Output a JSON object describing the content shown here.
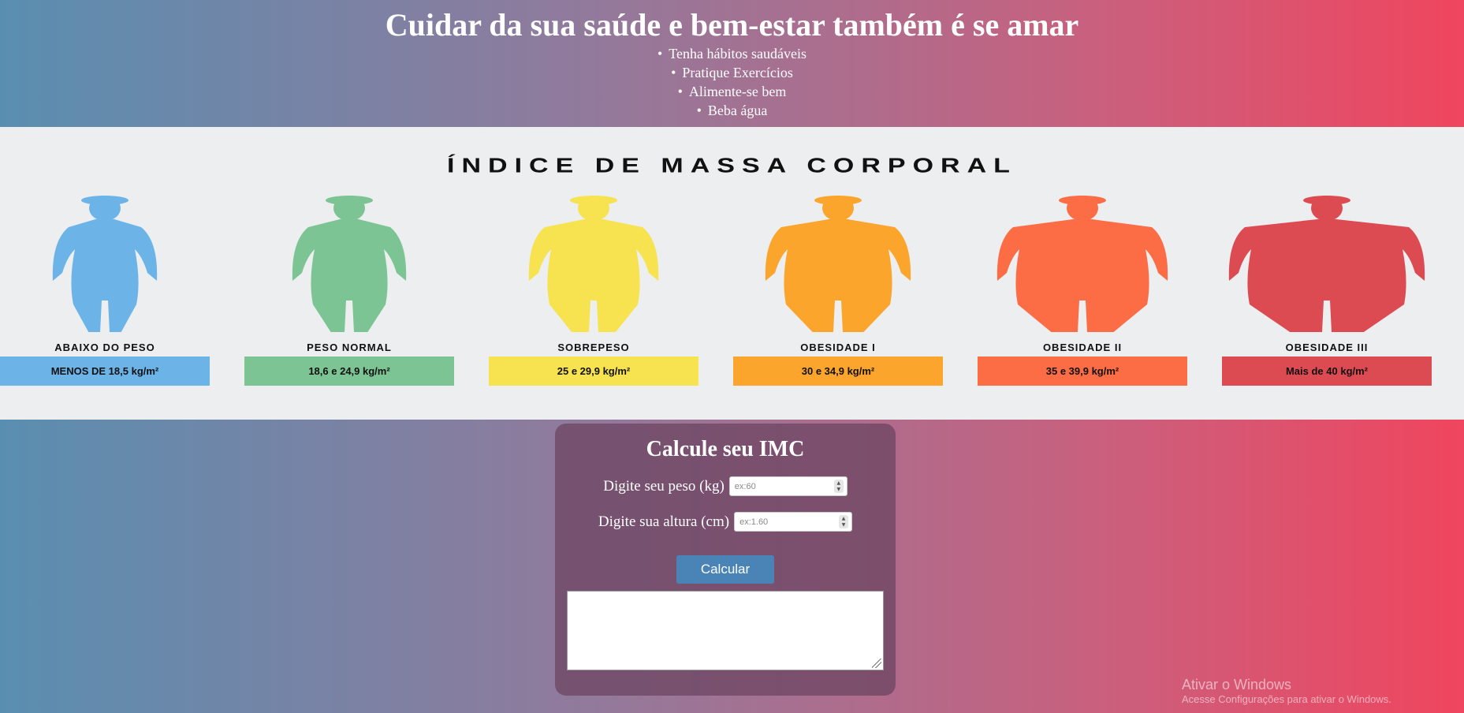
{
  "header": {
    "title": "Cuidar da sua saúde e bem-estar também é se amar",
    "tips": [
      "Tenha hábitos saudáveis",
      "Pratique Exercícios",
      "Alimente-se bem",
      "Beba água"
    ]
  },
  "banner": {
    "title": "ÍNDICE DE MASSA CORPORAL",
    "categories": [
      {
        "label": "ABAIXO DO PESO",
        "range": "MENOS DE 18,5 kg/m²",
        "color": "#6cb4e8"
      },
      {
        "label": "PESO NORMAL",
        "range": "18,6 e 24,9 kg/m²",
        "color": "#7cc493"
      },
      {
        "label": "SOBREPESO",
        "range": "25 e 29,9 kg/m²",
        "color": "#f6e34f"
      },
      {
        "label": "OBESIDADE I",
        "range": "30 e 34,9 kg/m²",
        "color": "#fba52c"
      },
      {
        "label": "OBESIDADE II",
        "range": "35 e 39,9 kg/m²",
        "color": "#fc6c45"
      },
      {
        "label": "OBESIDADE III",
        "range": "Mais de 40 kg/m²",
        "color": "#dd4b52"
      }
    ]
  },
  "form": {
    "title": "Calcule seu IMC",
    "weight_label": "Digite seu peso (kg)",
    "weight_placeholder": "ex:60",
    "height_label": "Digite sua altura (cm)",
    "height_placeholder": "ex:1.60",
    "button_label": "Calcular",
    "result_text": ""
  },
  "watermark": {
    "line1": "Ativar o Windows",
    "line2": "Acesse Configurações para ativar o Windows."
  }
}
